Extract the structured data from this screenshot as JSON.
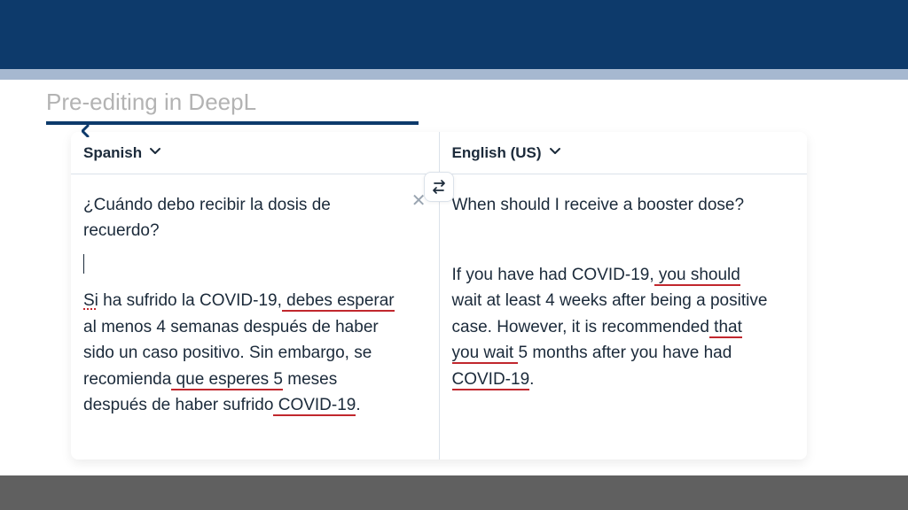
{
  "page": {
    "title": "Pre-editing in DeepL"
  },
  "translator": {
    "source_lang": "Spanish",
    "target_lang": "English (US)",
    "source": {
      "q": "¿Cuándo debo recibir la dosis de recuerdo?",
      "p1a": "Si",
      "p1b": " ha sufrido la COVID-19,",
      "p1c": " debes esperar",
      "p1d": " al menos 4 semanas después de haber sido un caso positivo. Sin embargo, se recomienda",
      "p1e": " que esperes 5",
      "p1f": " meses después de haber sufrido",
      "p1g": " COVID-19",
      "p1h": "."
    },
    "target": {
      "q": "When should I receive a booster dose?",
      "p1a": "If you have had COVID-19,",
      "p1b": " you should",
      "p1c": " wait at least 4 weeks after being a positive case. However, it is recommended",
      "p1d": " that you wait ",
      "p1e": "5 months after you have had",
      "p1f": " COVID-19",
      "p1g": "."
    }
  }
}
